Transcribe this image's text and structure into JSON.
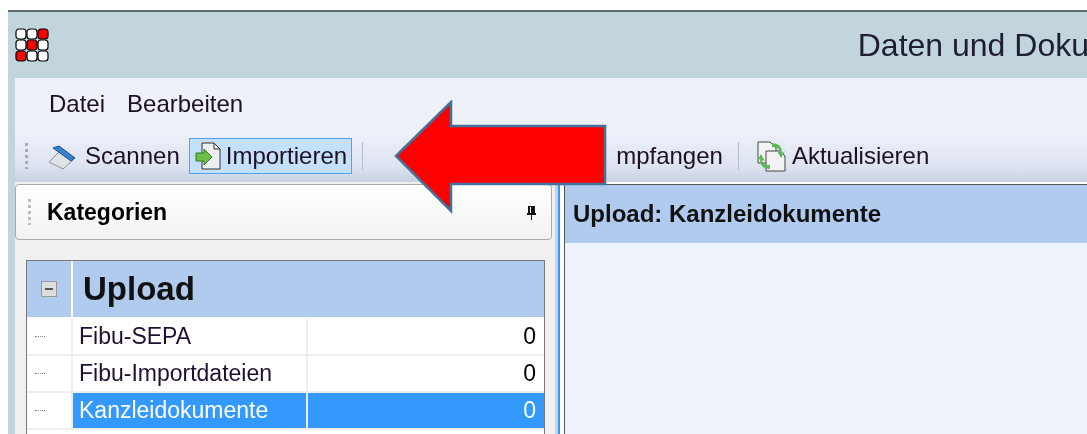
{
  "window": {
    "title": "Daten und Doku"
  },
  "menu": [
    "Datei",
    "Bearbeiten"
  ],
  "toolbar": [
    {
      "label": "Scannen",
      "kind": "scanner",
      "selected": false,
      "separator_before": false
    },
    {
      "label": "Importieren",
      "kind": "import",
      "selected": true,
      "separator_before": false
    },
    {
      "label": "mpfangen",
      "kind": "hidden",
      "selected": false,
      "separator_before": true
    },
    {
      "label": "Aktualisieren",
      "kind": "refresh",
      "selected": false,
      "separator_before": true
    }
  ],
  "categories_panel": {
    "title": "Kategorien",
    "tree": [
      {
        "label": "Upload",
        "expanded": true,
        "children": [
          {
            "label": "Fibu-SEPA",
            "count": "0",
            "selected": false
          },
          {
            "label": "Fibu-Importdateien",
            "count": "0",
            "selected": false
          },
          {
            "label": "Kanzleidokumente",
            "count": "0",
            "selected": true
          }
        ]
      }
    ]
  },
  "detail_panel": {
    "title": "Upload: Kanzleidokumente"
  }
}
